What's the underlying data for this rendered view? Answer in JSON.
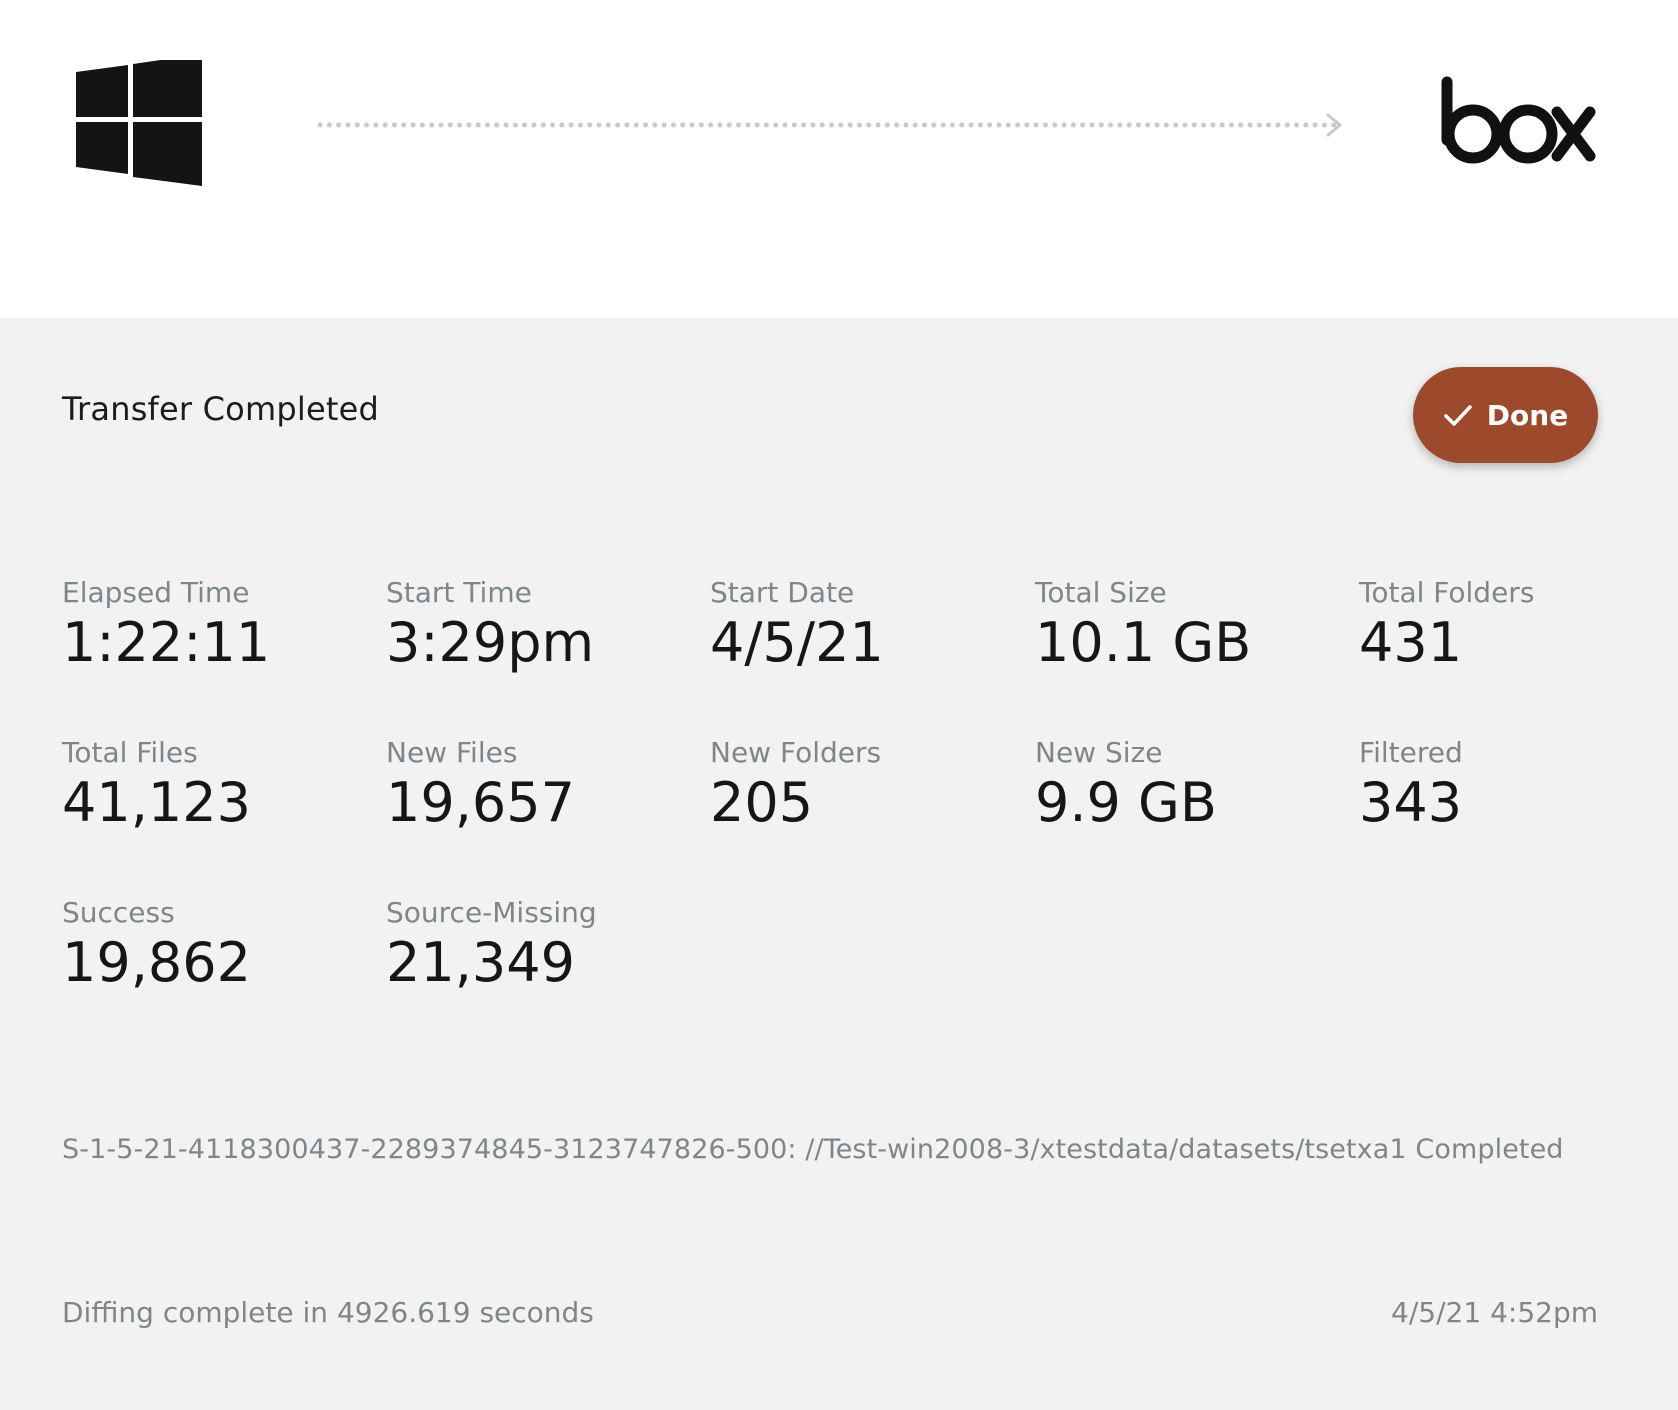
{
  "header": {
    "source_icon": "windows-logo-icon",
    "flow_icon": "dotted-arrow-icon",
    "destination_logo_text": "box"
  },
  "status": {
    "title": "Transfer Completed",
    "done_label": "Done",
    "done_icon": "checkmark-icon",
    "done_color": "#9c4a2b"
  },
  "stats": [
    {
      "label": "Elapsed Time",
      "value": "1:22:11"
    },
    {
      "label": "Start Time",
      "value": "3:29pm"
    },
    {
      "label": "Start Date",
      "value": "4/5/21"
    },
    {
      "label": "Total Size",
      "value": "10.1 GB"
    },
    {
      "label": "Total Folders",
      "value": "431"
    },
    {
      "label": "Total Files",
      "value": "41,123"
    },
    {
      "label": "New Files",
      "value": "19,657"
    },
    {
      "label": "New Folders",
      "value": "205"
    },
    {
      "label": "New Size",
      "value": "9.9 GB"
    },
    {
      "label": "Filtered",
      "value": "343"
    },
    {
      "label": "Success",
      "value": "19,862"
    },
    {
      "label": "Source-Missing",
      "value": "21,349"
    }
  ],
  "log": {
    "path": "S-1-5-21-4118300437-2289374845-3123747826-500: //Test-win2008-3/xtestdata/datasets/tsetxa1",
    "state": "Completed"
  },
  "footer": {
    "diff_message": "Diffing complete in 4926.619 seconds",
    "timestamp": "4/5/21 4:52pm"
  }
}
